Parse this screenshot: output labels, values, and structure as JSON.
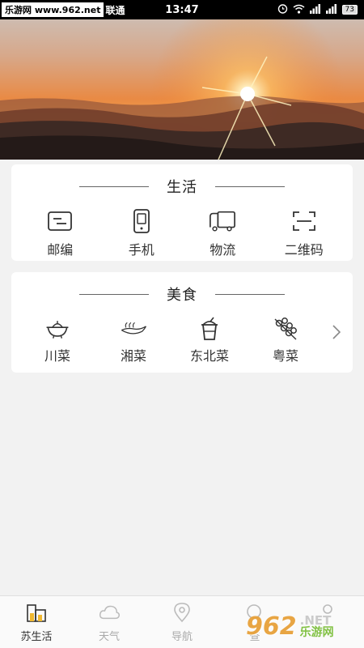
{
  "status_bar": {
    "site_watermark": "乐游网 www.962.net",
    "carrier": "联通",
    "time": "13:47",
    "battery": "73"
  },
  "sections": {
    "life": {
      "title": "生活",
      "items": [
        {
          "label": "邮编",
          "icon": "postcode-icon"
        },
        {
          "label": "手机",
          "icon": "phone-icon"
        },
        {
          "label": "物流",
          "icon": "truck-icon"
        },
        {
          "label": "二维码",
          "icon": "qrcode-scan-icon"
        }
      ]
    },
    "food": {
      "title": "美食",
      "items": [
        {
          "label": "川菜",
          "icon": "hotpot-icon"
        },
        {
          "label": "湘菜",
          "icon": "chili-dish-icon"
        },
        {
          "label": "东北菜",
          "icon": "drink-cup-icon"
        },
        {
          "label": "粤菜",
          "icon": "skewer-icon"
        }
      ]
    }
  },
  "tabbar": {
    "tabs": [
      {
        "label": "苏生活",
        "icon": "buildings-icon",
        "active": true
      },
      {
        "label": "天气",
        "icon": "cloud-icon",
        "active": false
      },
      {
        "label": "导航",
        "icon": "location-pin-icon",
        "active": false
      },
      {
        "label": "查",
        "icon": "search-icon",
        "active": false
      },
      {
        "label": "",
        "icon": "profile-icon",
        "active": false
      }
    ]
  },
  "watermark": {
    "brand": "962",
    "net": ".NET",
    "cn": "乐游网"
  },
  "colors": {
    "active_tab": "#333333",
    "inactive_tab": "#aaaaaa",
    "background": "#f2f2f2",
    "card": "#ffffff"
  }
}
